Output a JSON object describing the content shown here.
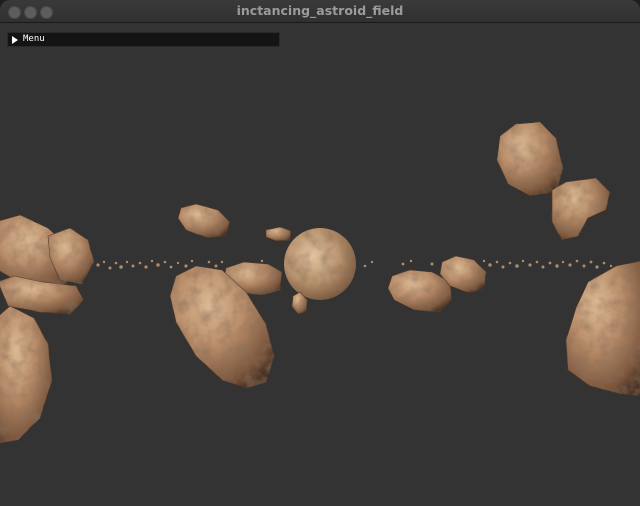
{
  "window": {
    "title": "inctancing_astroid_field"
  },
  "menu": {
    "label": "Menu",
    "expand_icon": "triangle-right-icon"
  },
  "colors": {
    "background": "#333333",
    "rock_light": "#c9a27e",
    "rock_mid": "#9b7153",
    "rock_dark": "#5c3f2c",
    "planet": "#b89672"
  }
}
